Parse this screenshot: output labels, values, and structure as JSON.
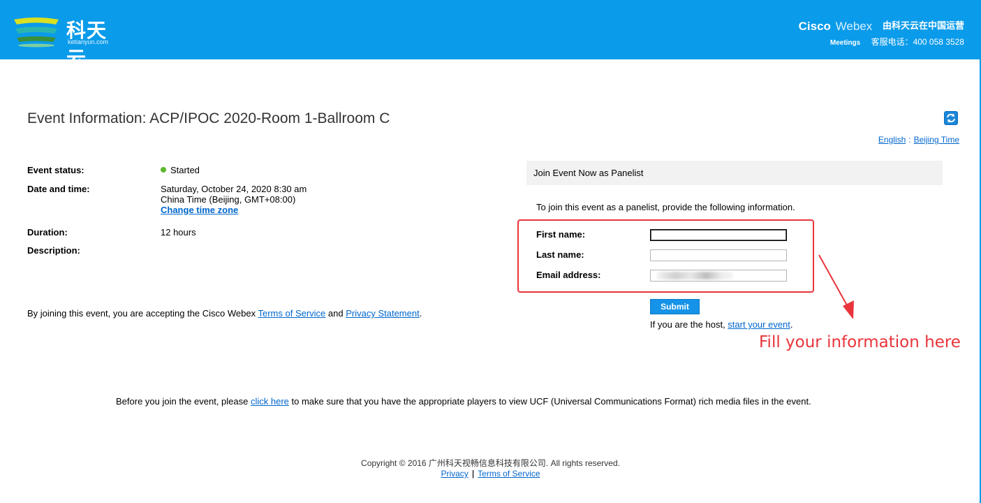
{
  "header": {
    "logo_cn": "科天云",
    "logo_en": "ketianyun.com",
    "brand_cisco": "Cisco",
    "brand_webex": "Webex",
    "brand_operated": "由科天云在中国运营",
    "brand_meetings": "Meetings",
    "hotline": "客服电话：400 058 3528",
    "background_color": "#0a9bea"
  },
  "page": {
    "title": "Event Information: ACP/IPOC 2020-Room 1-Ballroom C",
    "refresh_icon": "refresh-icon",
    "locale": {
      "language": "English",
      "separator": ":",
      "timezone": "Beijing Time"
    }
  },
  "event": {
    "status_label": "Event status:",
    "status_value": "Started",
    "status_color": "#5cb82e",
    "datetime_label": "Date and time:",
    "datetime_line1": "Saturday, October 24, 2020 8:30 am",
    "datetime_line2": "China Time (Beijing, GMT+08:00)",
    "change_timezone": "Change time zone",
    "duration_label": "Duration:",
    "duration_value": "12 hours",
    "description_label": "Description:"
  },
  "terms": {
    "prefix": "By joining this event, you are accepting the Cisco Webex ",
    "tos_link": "Terms of Service",
    "and": " and ",
    "privacy_link": "Privacy Statement",
    "suffix": "."
  },
  "join_panel": {
    "header": "Join Event Now as Panelist",
    "instruction": "To join this event as a panelist, provide the following information.",
    "first_name_label": "First name:",
    "first_name_value": "",
    "last_name_label": "Last name:",
    "last_name_value": "",
    "email_label": "Email address:",
    "submit_label": "Submit",
    "host_prefix": "If you are the host, ",
    "host_link": "start your event",
    "host_suffix": "."
  },
  "annotation": {
    "text": "Fill your information here",
    "color": "#e8343a"
  },
  "notice": {
    "prefix": "Before you join the event, please ",
    "link": "click here",
    "suffix": " to make sure that you have the appropriate players to view UCF (Universal Communications Format) rich media files in the event."
  },
  "footer": {
    "copyright": "Copyright © 2016 广州科天视畅信息科技有限公司. All rights reserved.",
    "privacy": "Privacy",
    "separator": "|",
    "terms": "Terms of Service"
  }
}
